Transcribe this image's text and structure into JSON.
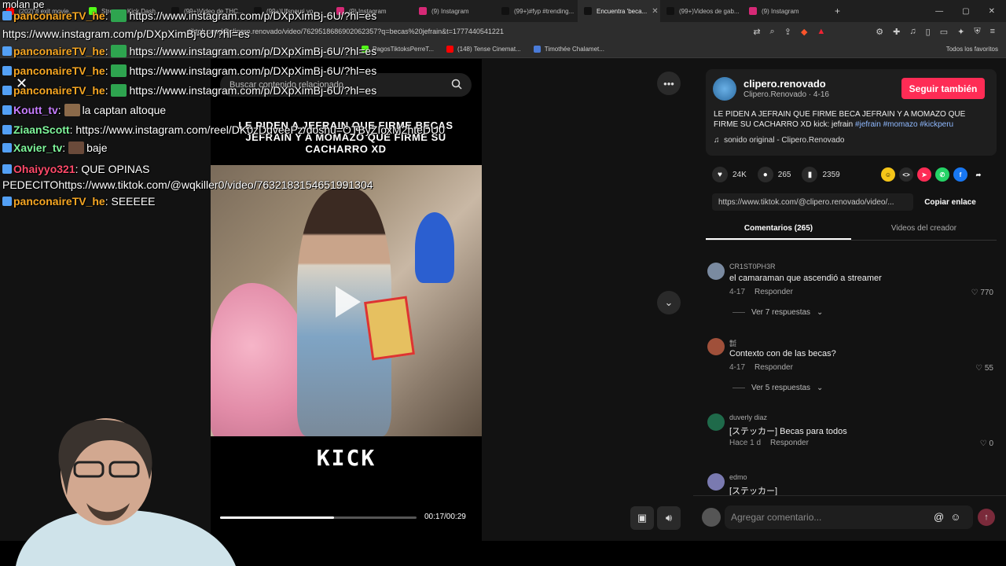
{
  "browser": {
    "tabs": [
      {
        "label": "(202) 8 exit movie...",
        "color": "#ff0000"
      },
      {
        "label": "Stream - Kick Dash...",
        "color": "#53fc18"
      },
      {
        "label": "(99+)Video de THC...",
        "color": "#111"
      },
      {
        "label": "(99+)Ufsneuri yo...",
        "color": "#111"
      },
      {
        "label": "(9) Instagram",
        "color": "#d62976"
      },
      {
        "label": "(9) Instagram",
        "color": "#d62976"
      },
      {
        "label": "(99+)#fyp #trending...",
        "color": "#111"
      },
      {
        "label": "Encuentra 'beca...",
        "color": "#111",
        "active": true
      },
      {
        "label": "(99+)Videos de gab...",
        "color": "#111"
      },
      {
        "label": "(9) Instagram",
        "color": "#d62976"
      }
    ],
    "url": "tiktok.com/@clipero.renovado/video/7629518686902062357?q=becas%20jefrain&t=1777440541221",
    "bookmarks": [
      {
        "label": "PagosTiktoksPerreT...",
        "color": "#53fc18"
      },
      {
        "label": "(148) Tense Cinemat...",
        "color": "#ff0000"
      },
      {
        "label": "Timothée Chalamet...",
        "color": "#4a7bd8"
      }
    ],
    "all_favorites": "Todos los favoritos"
  },
  "chat": {
    "top_text": "molan pe",
    "lines": [
      {
        "user": "panconaireTV_he",
        "user_color": "#f5a623",
        "text": "https://www.instagram.com/p/DXpXimBj-6U/?hl=es",
        "emote": "#2ea44f"
      },
      {
        "user": "",
        "user_color": "#fff",
        "text": "https://www.instagram.com/p/DXpXimBj-6U/?hl=es",
        "emote": ""
      },
      {
        "user": "panconaireTV_he",
        "user_color": "#f5a623",
        "text": "https://www.instagram.com/p/DXpXimBj-6U/?hl=es",
        "emote": "#2ea44f"
      },
      {
        "user": "panconaireTV_he",
        "user_color": "#f5a623",
        "text": "https://www.instagram.com/p/DXpXimBj-6U/?hl=es",
        "emote": "#2ea44f"
      },
      {
        "user": "panconaireTV_he",
        "user_color": "#f5a623",
        "text": "https://www.instagram.com/p/DXpXimBj-6U/?hl=es",
        "emote": "#2ea44f"
      },
      {
        "user": "Koutt_tv",
        "user_color": "#c77dff",
        "text": "la captan altoque",
        "emote": "#8b6a4a"
      },
      {
        "user": "ZiaanScott",
        "user_color": "#7ef59a",
        "text": "https://www.instagram.com/reel/DK0zDdveePz/doshu=OTByZIoxM2hteDU0",
        "emote": ""
      },
      {
        "user": "Xavier_tv",
        "user_color": "#7ef59a",
        "text": "baje",
        "emote": "#6a4a3a"
      },
      {
        "user": "Ohaiyyo321",
        "user_color": "#ff4a6a",
        "text": "QUE OPINAS PEDECITOhttps://www.tiktok.com/@wqkiller0/video/7632183154651991304",
        "emote": ""
      },
      {
        "user": "panconaireTV_he",
        "user_color": "#f5a623",
        "text": "SEEEEE",
        "emote": ""
      }
    ]
  },
  "video": {
    "search_placeholder": "Buscar contenido relacionado",
    "caption": "LE PIDEN A JEFRAIN QUE FIRME BECAS JEFRAIN Y A MOMAZO QUE FIRME SU CACHARRO XD",
    "watermark": "KICK",
    "time": "00:17/00:29",
    "progress": 0.58
  },
  "creator": {
    "name": "clipero.renovado",
    "sub": "Clipero.Renovado · 4-16",
    "follow": "Seguir también",
    "description": "LE PIDEN A JEFRAIN QUE FIRME BECA JEFRAIN Y A MOMAZO QUE FIRME SU CACHARRO XD kick: jefrain",
    "tags": "#jefrain #momazo #kickperu",
    "music": "sonido original - Clipero.Renovado",
    "likes": "24K",
    "comments": "265",
    "saves": "2359",
    "link": "https://www.tiktok.com/@clipero.renovado/video/...",
    "copy": "Copiar enlace"
  },
  "tabs": {
    "comments": "Comentarios (265)",
    "creator_videos": "Videos del creador"
  },
  "comments": [
    {
      "user": "CR1ST0PH3R",
      "text": "el camaraman que ascendió a streamer",
      "date": "4-17",
      "reply": "Responder",
      "likes": "770",
      "more": "Ver 7 respuestas",
      "color": "#7a8aa0"
    },
    {
      "user": "㍿",
      "text": "Contexto con de las becas?",
      "date": "4-17",
      "reply": "Responder",
      "likes": "55",
      "more": "Ver 5 respuestas",
      "color": "#a0503a"
    },
    {
      "user": "duverly diaz",
      "text": "[ステッカー] Becas para todos",
      "date": "Hace 1 d",
      "reply": "Responder",
      "likes": "0",
      "more": "",
      "color": "#1f6a4a"
    },
    {
      "user": "edmo",
      "text": "[ステッカー]",
      "date": "",
      "reply": "",
      "likes": "",
      "more": "",
      "color": "#7a7ab0"
    }
  ],
  "add_comment": {
    "placeholder": "Agregar comentario..."
  }
}
